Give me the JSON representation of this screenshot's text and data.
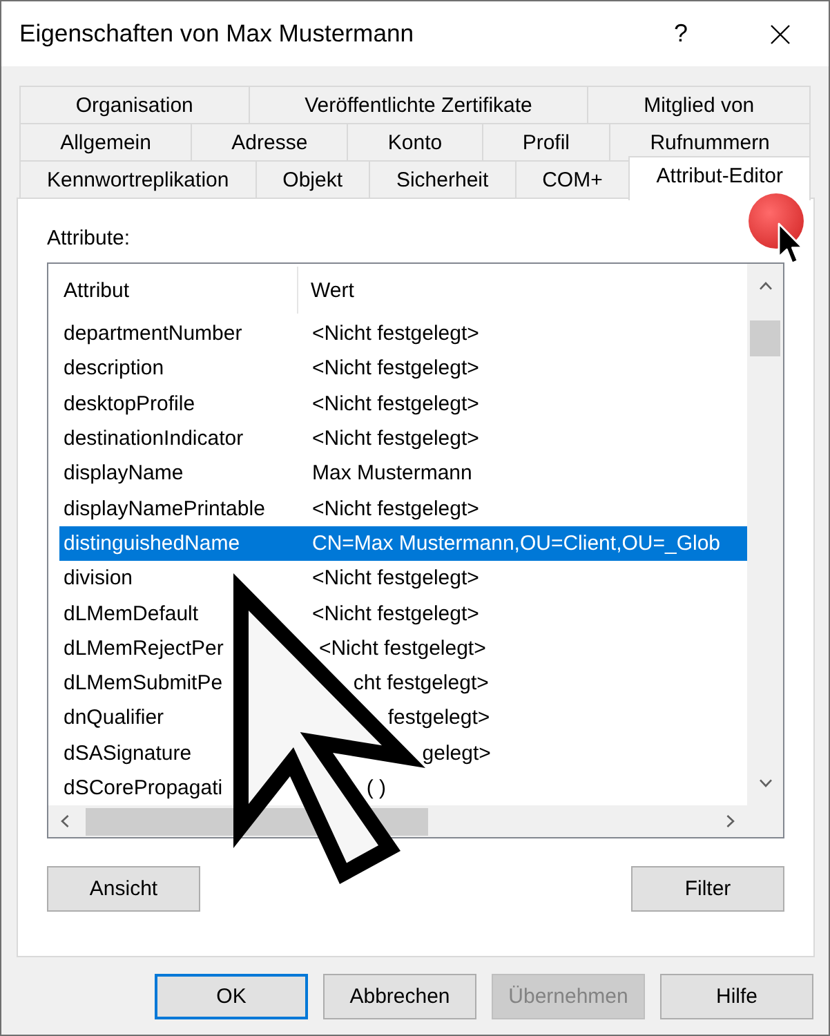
{
  "window": {
    "title": "Eigenschaften von Max Mustermann",
    "help_button": "?"
  },
  "tab_rows": [
    {
      "tabs": [
        {
          "label": "Organisation",
          "selected": false
        },
        {
          "label": "Veröffentlichte Zertifikate",
          "selected": false
        },
        {
          "label": "Mitglied von",
          "selected": false
        }
      ]
    },
    {
      "tabs": [
        {
          "label": "Allgemein",
          "selected": false
        },
        {
          "label": "Adresse",
          "selected": false
        },
        {
          "label": "Konto",
          "selected": false
        },
        {
          "label": "Profil",
          "selected": false
        },
        {
          "label": "Rufnummern",
          "selected": false
        }
      ]
    },
    {
      "tabs": [
        {
          "label": "Kennwortreplikation",
          "selected": false
        },
        {
          "label": "Objekt",
          "selected": false
        },
        {
          "label": "Sicherheit",
          "selected": false
        },
        {
          "label": "COM+",
          "selected": false
        },
        {
          "label": "Attribut-Editor",
          "selected": true
        }
      ]
    }
  ],
  "attribute_editor": {
    "label": "Attribute:",
    "columns": [
      "Attribut",
      "Wert"
    ],
    "rows": [
      {
        "attribute": "departmentNumber",
        "value": "<Nicht festgelegt>",
        "selected": false
      },
      {
        "attribute": "description",
        "value": "<Nicht festgelegt>",
        "selected": false
      },
      {
        "attribute": "desktopProfile",
        "value": "<Nicht festgelegt>",
        "selected": false
      },
      {
        "attribute": "destinationIndicator",
        "value": "<Nicht festgelegt>",
        "selected": false
      },
      {
        "attribute": "displayName",
        "value": "Max Mustermann",
        "selected": false
      },
      {
        "attribute": "displayNamePrintable",
        "value": "<Nicht festgelegt>",
        "selected": false
      },
      {
        "attribute": "distinguishedName",
        "value": "CN=Max Mustermann,OU=Client,OU=_Glob",
        "selected": true
      },
      {
        "attribute": "division",
        "value": "<Nicht festgelegt>",
        "selected": false
      },
      {
        "attribute": "dLMemDefault",
        "value": "<Nicht festgelegt>",
        "selected": false
      },
      {
        "attribute": "dLMemRejectPer",
        "value": "<Nicht festgelegt>",
        "selected": false
      },
      {
        "attribute": "dLMemSubmitPe",
        "value": "cht festgelegt>",
        "selected": false
      },
      {
        "attribute": "dnQualifier",
        "value": "festgelegt>",
        "selected": false
      },
      {
        "attribute": "dSASignature",
        "value": "gelegt>",
        "selected": false
      },
      {
        "attribute": "dSCorePropagati",
        "value": "( )",
        "selected": false
      }
    ],
    "buttons": [
      "Ansicht",
      "Filter"
    ]
  },
  "buttons": [
    {
      "label": "OK",
      "default": true,
      "disabled": false
    },
    {
      "label": "Abbrechen",
      "default": false,
      "disabled": false
    },
    {
      "label": "Übernehmen",
      "default": false,
      "disabled": true
    },
    {
      "label": "Hilfe",
      "default": false,
      "disabled": false
    }
  ]
}
